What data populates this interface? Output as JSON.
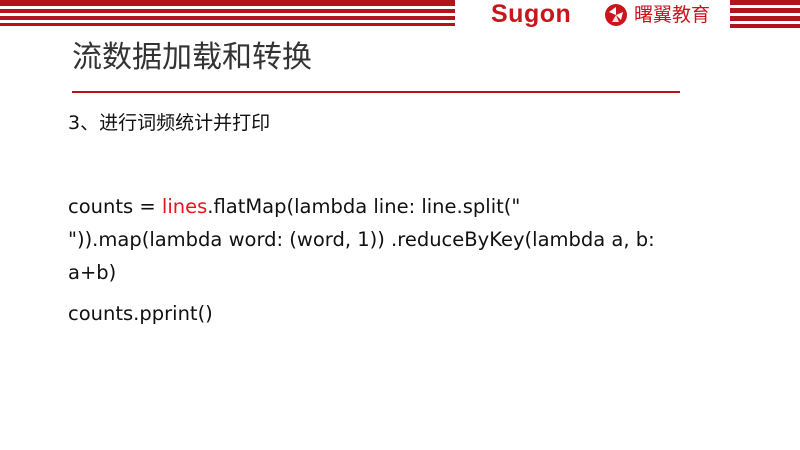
{
  "header": {
    "brand_sugon": "Sugon",
    "brand_ruiyi": "曙翼教育",
    "brand_ruiyi_icon": "ruiyi-logo-icon",
    "accent_color": "#b3141c"
  },
  "slide": {
    "title": "流数据加载和转换",
    "subheading": "3、进行词频统计并打印",
    "code": {
      "line1_prefix": "counts = ",
      "line1_highlight": "lines",
      "line1_suffix": ".flatMap(lambda line: line.split(\"",
      "line2": "\")).map(lambda word: (word, 1)) .reduceByKey(lambda a, b:",
      "line3": "a+b)",
      "line4": "counts.pprint()",
      "highlight_color": "#e8141c"
    }
  }
}
